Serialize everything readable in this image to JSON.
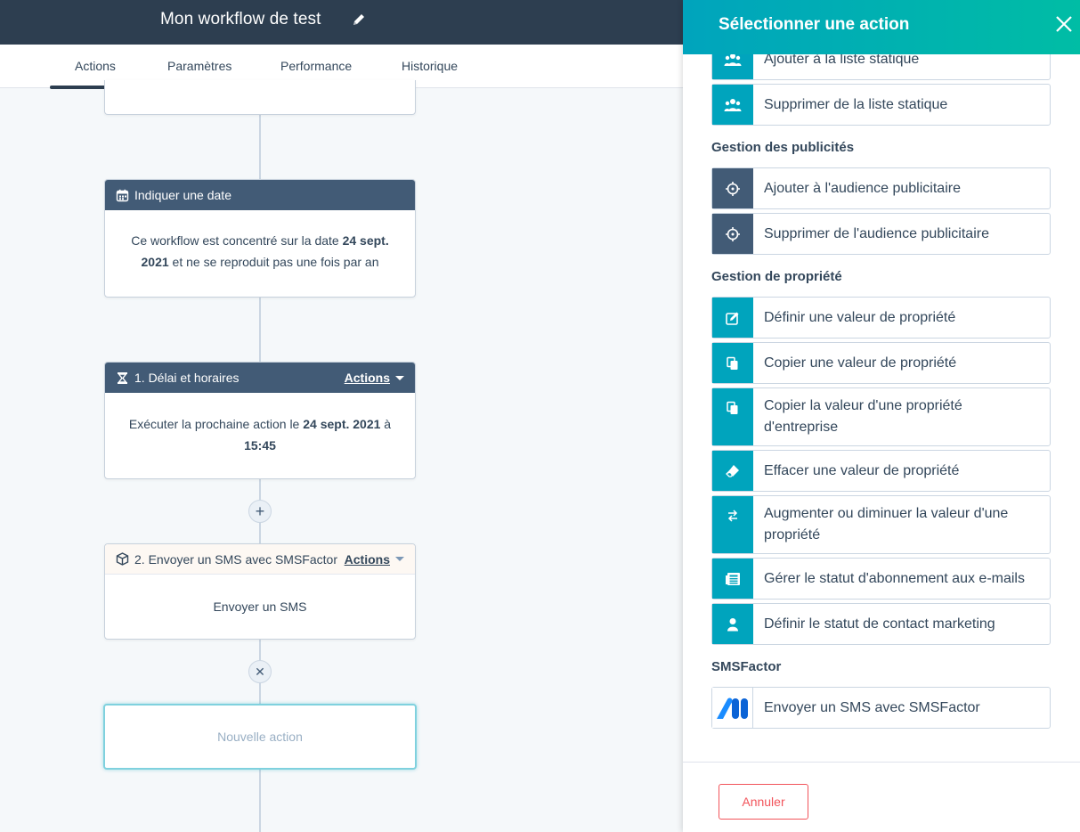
{
  "header": {
    "workflow_title": "Mon workflow de test",
    "tabs": [
      {
        "label": "Actions",
        "active": true
      },
      {
        "label": "Paramètres",
        "active": false
      },
      {
        "label": "Performance",
        "active": false
      },
      {
        "label": "Historique",
        "active": false
      }
    ]
  },
  "canvas": {
    "date_card": {
      "title": "Indiquer une date",
      "body_prefix": "Ce workflow est concentré sur la date ",
      "body_date": "24 sept. 2021",
      "body_suffix": " et ne se reproduit pas une fois par an"
    },
    "delay_card": {
      "title": "1. Délai et horaires",
      "actions_label": "Actions",
      "body_prefix": "Exécuter la prochaine action le ",
      "body_date": "24 sept. 2021",
      "body_mid": " à ",
      "body_time": "15:45"
    },
    "sms_card": {
      "title": "2. Envoyer un SMS avec SMSFactor",
      "actions_label": "Actions",
      "body": "Envoyer un SMS"
    },
    "add_symbol": "+",
    "remove_symbol": "✕",
    "new_action_label": "Nouvelle action"
  },
  "panel": {
    "title": "Sélectionner une action",
    "cancel_label": "Annuler",
    "colors": {
      "teal": "#00a4bd",
      "dark": "#425b76",
      "danger": "#f2545b"
    },
    "sections": [
      {
        "title": "",
        "options": [
          {
            "label": "Ajouter à la liste statique",
            "icon": "people-icon"
          },
          {
            "label": "Supprimer de la liste statique",
            "icon": "people-icon"
          }
        ]
      },
      {
        "title": "Gestion des publicités",
        "options": [
          {
            "label": "Ajouter à l'audience publicitaire",
            "icon": "target-icon"
          },
          {
            "label": "Supprimer de l'audience publicitaire",
            "icon": "target-icon"
          }
        ]
      },
      {
        "title": "Gestion de propriété",
        "options": [
          {
            "label": "Définir une valeur de propriété",
            "icon": "edit-icon"
          },
          {
            "label": "Copier une valeur de propriété",
            "icon": "copy-icon"
          },
          {
            "label": "Copier la valeur d'une propriété d'entreprise",
            "icon": "copy-icon"
          },
          {
            "label": "Effacer une valeur de propriété",
            "icon": "eraser-icon"
          },
          {
            "label": "Augmenter ou diminuer la valeur d'une propriété",
            "icon": "swap-arrows-icon"
          },
          {
            "label": "Gérer le statut d'abonnement aux e-mails",
            "icon": "newsletter-icon"
          },
          {
            "label": "Définir le statut de contact marketing",
            "icon": "contact-icon"
          }
        ]
      },
      {
        "title": "SMSFactor",
        "options": [
          {
            "label": "Envoyer un SMS avec SMSFactor",
            "icon": "smsfactor-logo-icon"
          }
        ]
      }
    ]
  }
}
